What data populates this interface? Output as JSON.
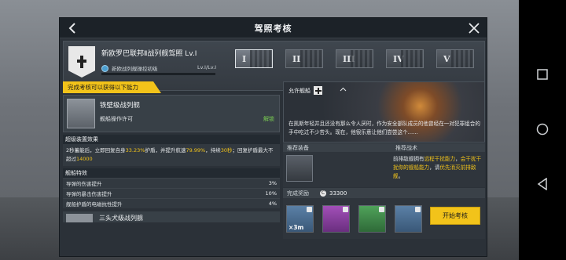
{
  "dialog": {
    "title": "驾照考核"
  },
  "header": {
    "license_title": "新欧罗巴联邦Ⅱ战列舰驾照 Lv.I",
    "sub_label": "新欧战列舰操控初级",
    "level": "Lv.I/Lv.I",
    "tiers": [
      "I",
      "II",
      "III",
      "IV",
      "V"
    ]
  },
  "left": {
    "banner": "完成考核可以获得以下能力",
    "ship1": {
      "name": "铁壁级战列舰",
      "permission": "舰船操作许可",
      "unlock": "解锁"
    },
    "upgrade": {
      "heading": "超级装置效果",
      "text_a": "2秒蓄能后，立即回复自身",
      "text_b": "33.23%",
      "text_c": "护盾，并提升航速",
      "text_d": "79.99%",
      "text_e": "，持续",
      "text_f": "30秒",
      "text_g": "；回复护盾最大不超过",
      "text_h": "14000"
    },
    "traits": {
      "heading": "舰船特效",
      "rows": [
        {
          "label": "导弹的伤害提升",
          "value": "3%"
        },
        {
          "label": "导弹的暴击伤害提升",
          "value": "10%"
        },
        {
          "label": "舰船护盾的电磁抗性提升",
          "value": "4%"
        }
      ]
    },
    "ship2": {
      "name": "三头犬级战列舰"
    }
  },
  "right": {
    "hero_label": "允许舰船",
    "hero_text": "在凯斯年轻并且还没有那么令人厌时，作为安全部队成员的他曾经在一对犯罪组合的手中吃过不少苦头。现在，他很乐意让他们尝尝这个……",
    "equip_heading": "推荐装备",
    "tactic_heading": "推荐战术",
    "tactic": {
      "a": "前排敌舰拥有",
      "b": "远程干扰能力",
      "c": "，",
      "d": "会干扰干扰你的舰船能力",
      "e": "，请",
      "f": "优先消灭前排敌舰",
      "g": "。"
    },
    "reward_heading": "完成奖励",
    "reward_coin_symbol": "C",
    "reward_coin": "33300",
    "rewards": [
      {
        "icon": "blueprint-icon",
        "qty": "×3m"
      },
      {
        "icon": "purple-gem-icon",
        "qty": ""
      },
      {
        "icon": "green-crystal-icon",
        "qty": ""
      },
      {
        "icon": "ore-icon",
        "qty": ""
      }
    ],
    "start_button": "开始考核"
  },
  "colors": {
    "accent": "#f2c31a",
    "unlock": "#7bcf52"
  }
}
